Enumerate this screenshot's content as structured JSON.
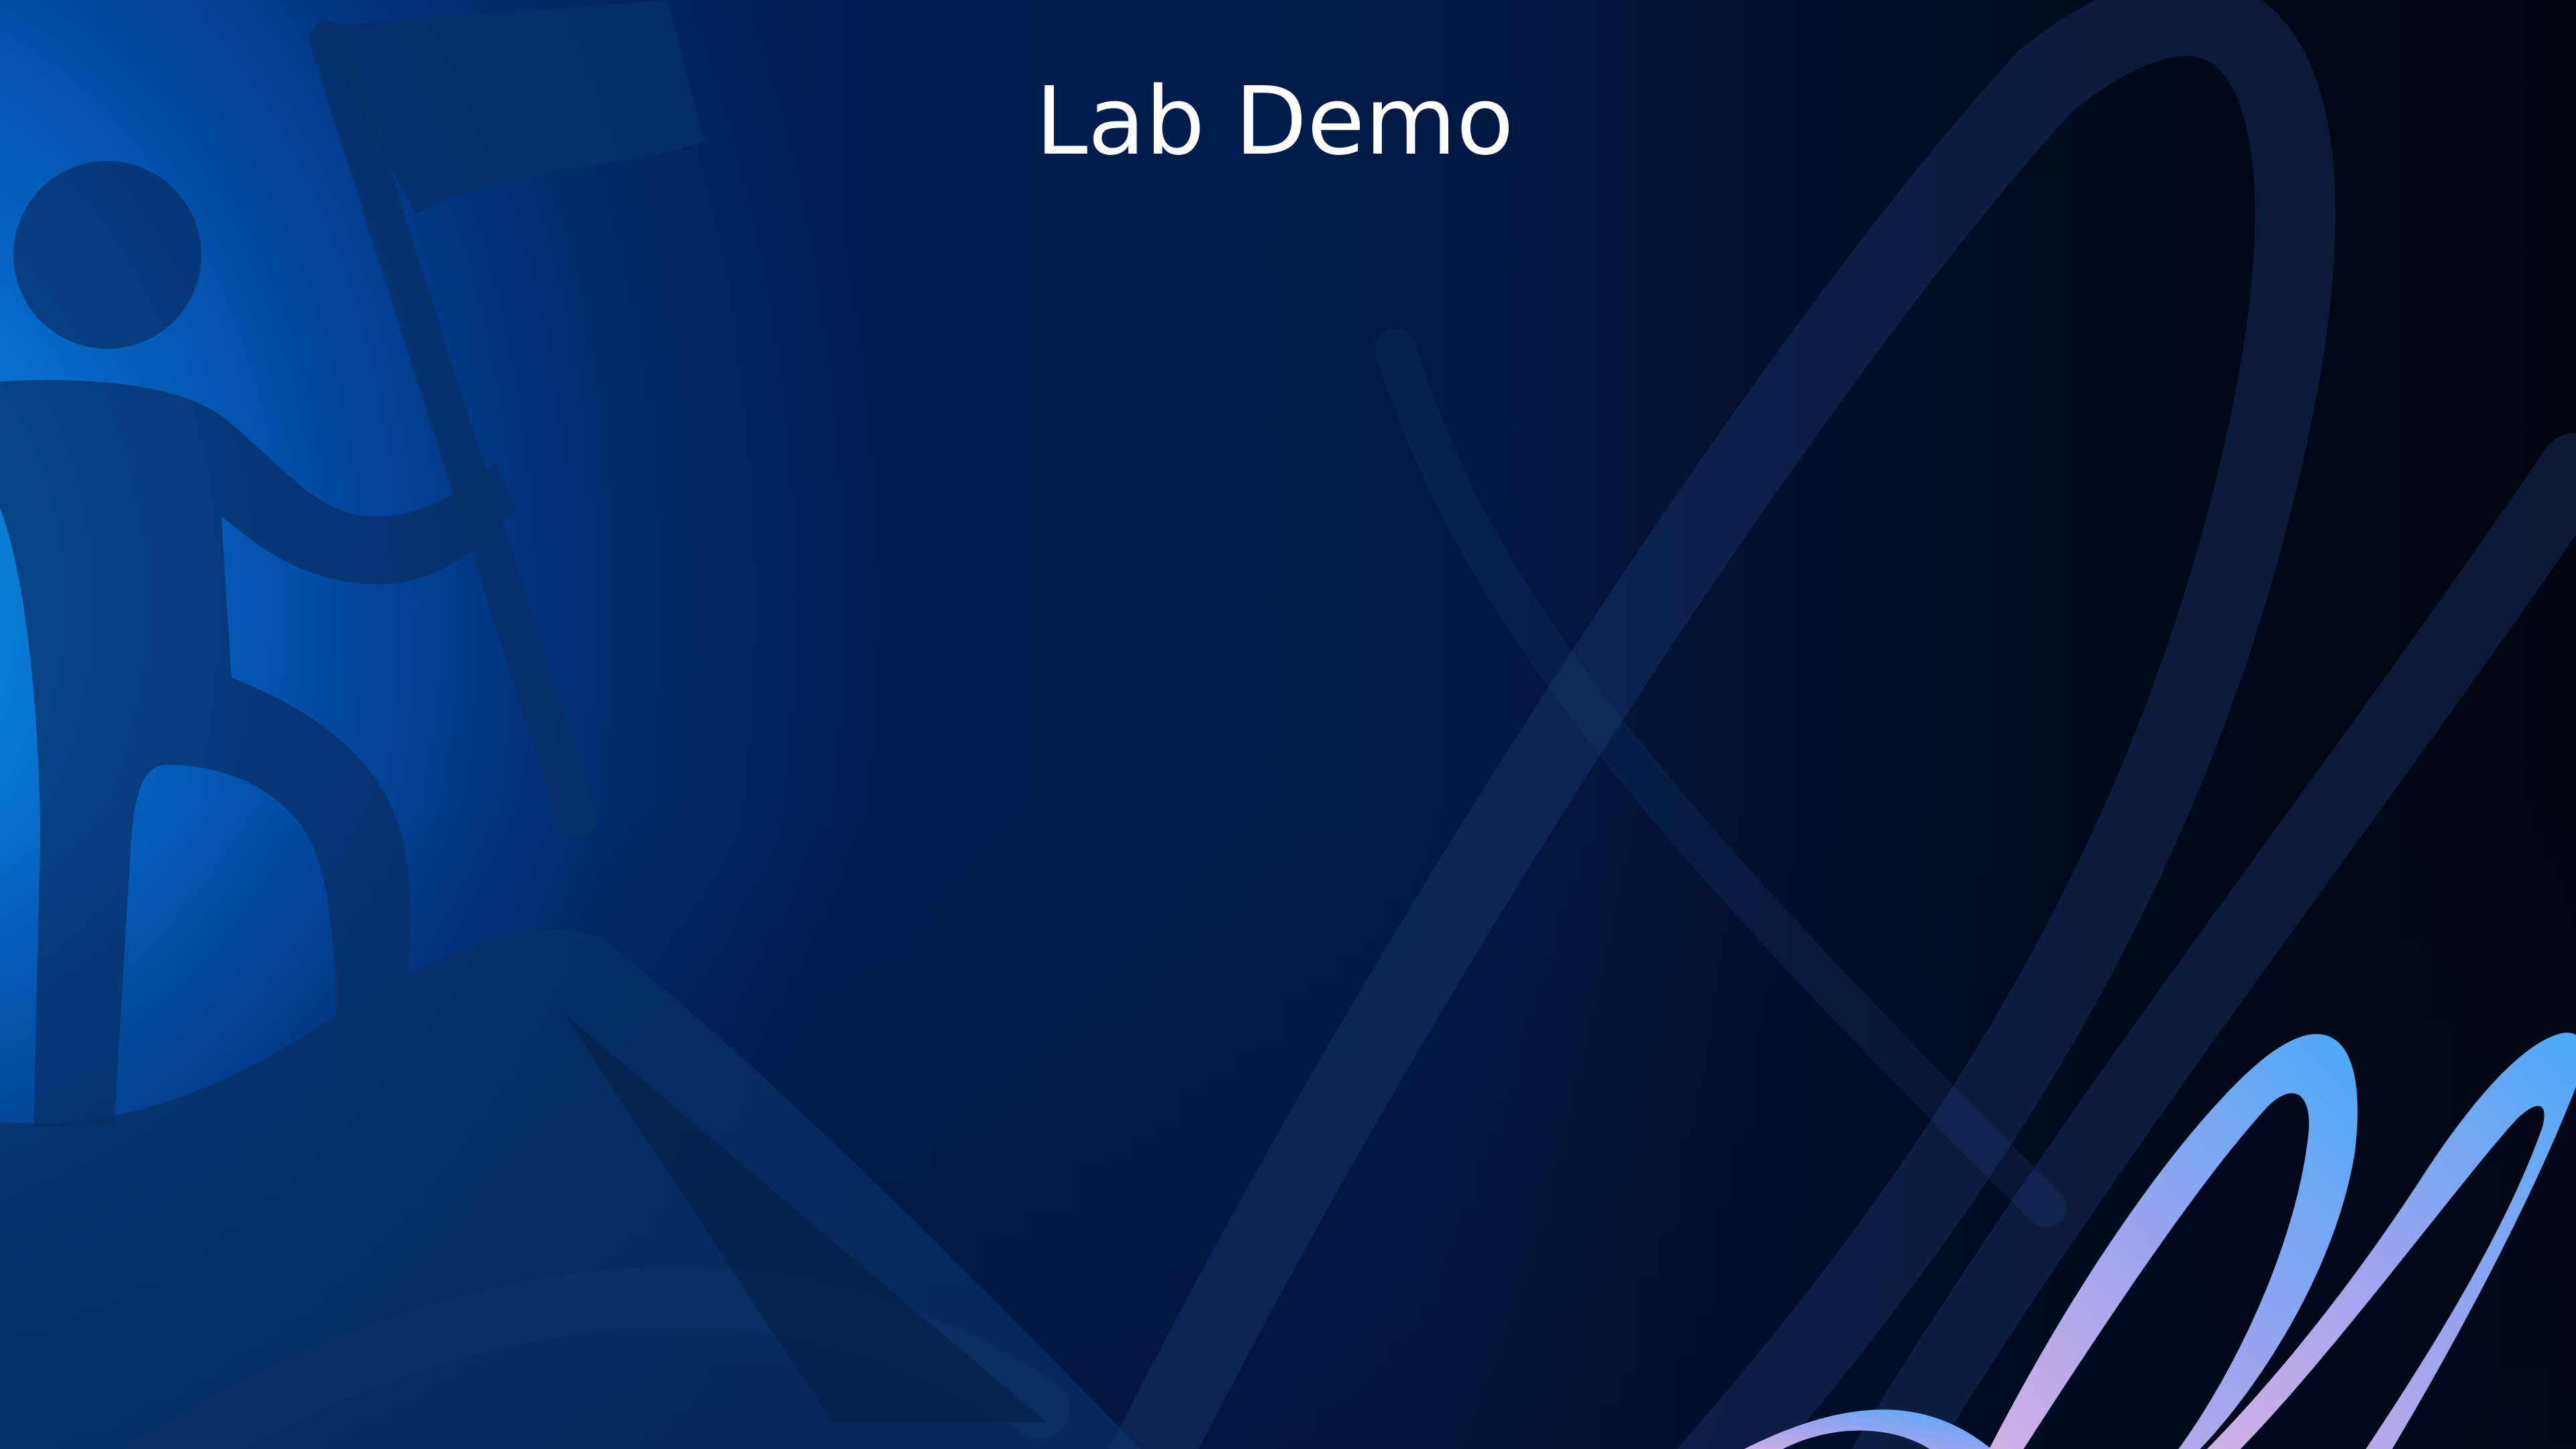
{
  "slide": {
    "title": "Lab Demo"
  },
  "colors": {
    "background_dark": "#000814",
    "background_blue": "#0668c8",
    "figure_shade": "#0a2f63",
    "ribbon_start": "#c4a8e8",
    "ribbon_end": "#52aaf8",
    "title_text": "#ffffff"
  },
  "decor": {
    "figure_icon": "person-with-flag-icon",
    "ribbon_icon": "ribbon-swoosh-icon"
  }
}
